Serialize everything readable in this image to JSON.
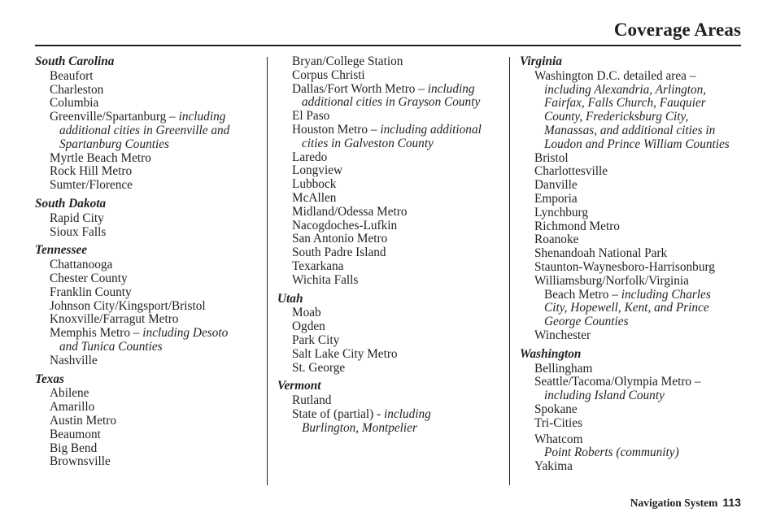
{
  "header": {
    "title": "Coverage Areas"
  },
  "footer": {
    "section": "Navigation System",
    "page": "113"
  },
  "columns": {
    "c1": {
      "sc": {
        "name": "South Carolina",
        "items": [
          "Beaufort",
          "Charleston",
          "Columbia"
        ],
        "greenville": {
          "main": "Greenville/Spartanburg – ",
          "note1": "including",
          "note2": "additional cities in Greenville and",
          "note3": "Spartanburg Counties"
        },
        "items2": [
          "Myrtle Beach Metro",
          "Rock Hill Metro",
          "Sumter/Florence"
        ]
      },
      "sd": {
        "name": "South Dakota",
        "items": [
          "Rapid City",
          "Sioux Falls"
        ]
      },
      "tn": {
        "name": "Tennessee",
        "items": [
          "Chattanooga",
          "Chester County",
          "Franklin County",
          "Johnson City/Kingsport/Bristol",
          "Knoxville/Farragut Metro"
        ],
        "memphis": {
          "main": "Memphis Metro – ",
          "note1": "including Desoto",
          "note2": "and Tunica Counties"
        },
        "items2": [
          "Nashville"
        ]
      },
      "tx": {
        "name": "Texas",
        "items": [
          "Abilene",
          "Amarillo",
          "Austin Metro",
          "Beaumont",
          "Big Bend",
          "Brownsville"
        ]
      }
    },
    "c2": {
      "tx_cont": {
        "items": [
          "Bryan/College Station",
          "Corpus Christi"
        ],
        "dallas": {
          "main": "Dallas/Fort Worth Metro – ",
          "note1": "including",
          "note2": "additional cities in Grayson County"
        },
        "items2": [
          "El Paso"
        ],
        "houston": {
          "main": "Houston Metro – ",
          "note1": "including additional",
          "note2": "cities in Galveston County"
        },
        "items3": [
          "Laredo",
          "Longview",
          "Lubbock",
          "McAllen",
          "Midland/Odessa Metro",
          "Nacogdoches-Lufkin",
          "San Antonio Metro",
          "South Padre Island",
          "Texarkana",
          "Wichita Falls"
        ]
      },
      "ut": {
        "name": "Utah",
        "items": [
          "Moab",
          "Ogden",
          "Park City",
          "Salt Lake City Metro",
          "St. George"
        ]
      },
      "vt": {
        "name": "Vermont",
        "items": [
          "Rutland"
        ],
        "state": {
          "main": "State of (partial) - ",
          "note1": "including",
          "note2": "Burlington, Montpelier"
        }
      }
    },
    "c3": {
      "va": {
        "name": "Virginia",
        "dc": {
          "main": "Washington D.C. detailed area –",
          "lines": [
            "including Alexandria, Arlington,",
            "Fairfax, Falls Church, Fauquier",
            "County, Fredericksburg City,",
            "Manassas, and additional cities in",
            "Loudon and Prince William Counties"
          ]
        },
        "items": [
          "Bristol",
          "Charlottesville",
          "Danville",
          "Emporia",
          "Lynchburg",
          "Richmond Metro",
          "Roanoke",
          "Shenandoah National Park",
          "Staunton-Waynesboro-Harrisonburg"
        ],
        "wb": {
          "main": "Williamsburg/Norfolk/Virginia",
          "line2main": "Beach Metro – ",
          "line2note": "including Charles",
          "lines": [
            "City, Hopewell, Kent, and Prince",
            "George Counties"
          ]
        },
        "items2": [
          "Winchester"
        ]
      },
      "wa": {
        "name": "Washington",
        "items": [
          "Bellingham"
        ],
        "seattle": {
          "main": "Seattle/Tacoma/Olympia Metro –",
          "note": "including Island County"
        },
        "items2": [
          "Spokane",
          "Tri-Cities"
        ],
        "whatcom": {
          "main": "Whatcom",
          "note": "Point Roberts (community)"
        },
        "items3": [
          "Yakima"
        ]
      }
    }
  }
}
